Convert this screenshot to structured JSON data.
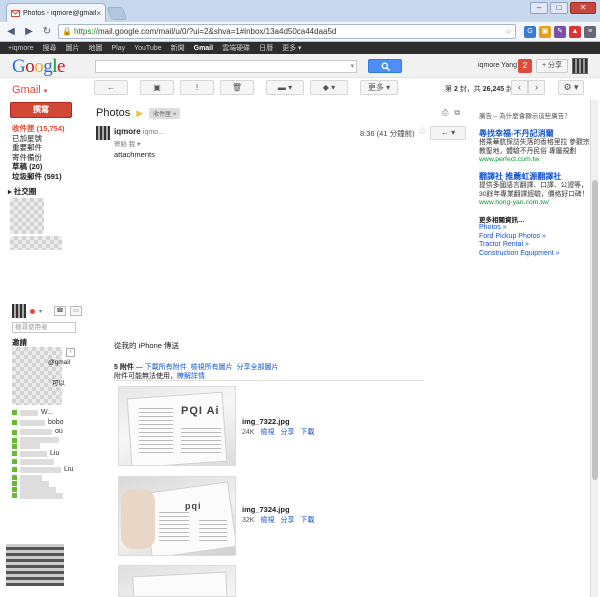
{
  "browser": {
    "tab_title": "Photos - iqmore@gmail...",
    "tab_close": "×",
    "url_https": "https://",
    "url_rest": "mail.google.com/mail/u/0/?ui=2&shva=1#inbox/13a4d50ca44daa5d",
    "win_min": "–",
    "win_max": "□",
    "win_close": "✕"
  },
  "gbar": {
    "items": [
      "+iqmore",
      "搜尋",
      "圖片",
      "地圖",
      "Play",
      "YouTube",
      "新聞",
      "Gmail",
      "雲端硬碟",
      "日曆",
      "更多 ▾"
    ],
    "active": "Gmail"
  },
  "header": {
    "logo": [
      "G",
      "o",
      "o",
      "g",
      "l",
      "e"
    ],
    "user": "iqmore Yang",
    "notifications": "2",
    "share": "+ 分享"
  },
  "gmail_label": "Gmail",
  "toolbar": {
    "back": "←",
    "archive": "▣",
    "spam": "!",
    "delete": "🗑",
    "move": "▬ ▾",
    "labels": "◆ ▾",
    "more": "更多 ▾",
    "pager_prefix": "第",
    "pager_current": "2",
    "pager_mid": "封，共",
    "pager_total": "26,245",
    "pager_suffix": "封",
    "prev": "‹",
    "next": "›",
    "settings": "⚙ ▾"
  },
  "sidebar": {
    "compose": "撰寫",
    "items": [
      {
        "label": "收件匣 (15,754)",
        "style": "inbox"
      },
      {
        "label": "已加星號",
        "style": ""
      },
      {
        "label": "重要郵件",
        "style": ""
      },
      {
        "label": "寄件備份",
        "style": ""
      },
      {
        "label": "草稿 (20)",
        "style": "bold"
      },
      {
        "label": "垃圾郵件 (591)",
        "style": "bold"
      }
    ],
    "social": "▸ 社交圈",
    "people_search": "搜尋使用者",
    "invites": "邀請",
    "contacts": [
      "@gmail",
      "可以",
      "W...",
      "bobo",
      "ou",
      "",
      "",
      "Liu",
      "",
      "Liu",
      "",
      "",
      "",
      ""
    ]
  },
  "message": {
    "subject": "Photos",
    "label": "收件匣 ×",
    "sender": "iqmore",
    "sender_email": "iqmo...",
    "to": "寄給 我 ▾",
    "time": "8:36 (41 分鐘前)",
    "star": "☆",
    "reply": "← ▾",
    "body": "attachments",
    "sent_from": "從我的 iPhone 傳送",
    "attach_count": "5 附件",
    "attach_sep": " — ",
    "download_all": "下載所有附件",
    "view_all": "檢視所有圖片",
    "share_all": "分享全部圖片",
    "attach_note": "附件可能無法使用，",
    "learn_more": "瞭解詳情"
  },
  "attachments": [
    {
      "name": "img_7322.jpg",
      "size": "24K",
      "view": "檢視",
      "share": "分享",
      "download": "下載",
      "thumb_text": "PQI Ai"
    },
    {
      "name": "img_7324.jpg",
      "size": "32K",
      "view": "檢視",
      "share": "分享",
      "download": "下載",
      "thumb_text": "pqi"
    }
  ],
  "ads": {
    "header": "廣告 – 為什麼會顯示這些廣告？",
    "items": [
      {
        "title": "尋找幸福-不丹記消爾",
        "desc": "搭乘華航探訪失落的香格里拉 參觀宗教聖地，體驗不丹民俗 專屬規劃",
        "url": "www.perfect.com.tw"
      },
      {
        "title": "翻譯社 推薦虹源翻譯社",
        "desc": "提供多國語言翻譯、口譯、公證等，30餘年專業翻譯經驗，價格好口碑！",
        "url": "www.hong-yan.com.tw/"
      }
    ],
    "more_header": "更多相關資訊…",
    "more_links": [
      "Photos »",
      "Ford Pickup Photos »",
      "Tractor Rental »",
      "Construction Equipment »"
    ]
  },
  "icons": {
    "back": "arrow-left-icon",
    "forward": "arrow-right-icon",
    "reload": "reload-icon",
    "home": "home-icon",
    "star": "star-icon",
    "gear": "gear-icon",
    "print": "print-icon",
    "new-window": "new-window-icon"
  }
}
